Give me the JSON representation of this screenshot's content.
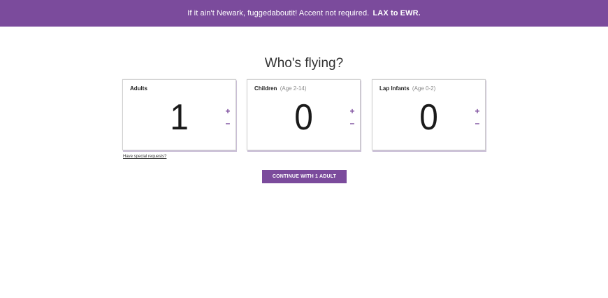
{
  "banner": {
    "message": "If it ain't Newark, fuggedaboutit! Accent not required.",
    "route": "LAX to EWR."
  },
  "page_title": "Who's flying?",
  "passengers": [
    {
      "label": "Adults",
      "sublabel": "",
      "count": "1",
      "plus": "+",
      "minus": "–"
    },
    {
      "label": "Children",
      "sublabel": "(Age 2-14)",
      "count": "0",
      "plus": "+",
      "minus": "–"
    },
    {
      "label": "Lap Infants",
      "sublabel": "(Age 0-2)",
      "count": "0",
      "plus": "+",
      "minus": "–"
    }
  ],
  "special_requests_link": "Have special requests?",
  "continue_button": "CONTINUE WITH 1 ADULT",
  "colors": {
    "brand_purple": "#7b4b9c"
  }
}
